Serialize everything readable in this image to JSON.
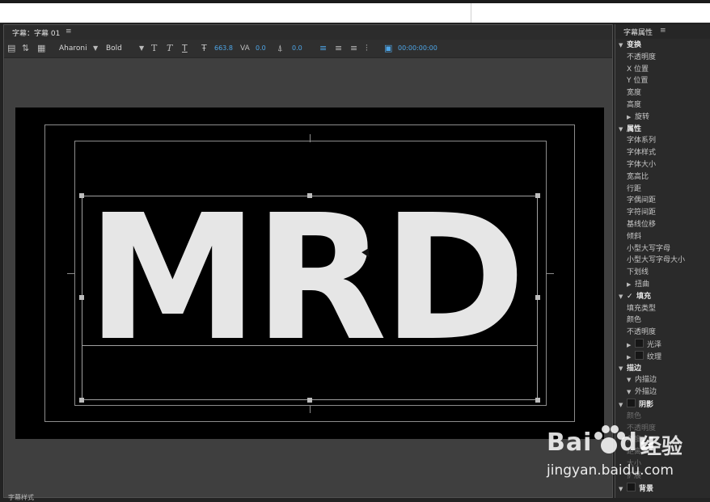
{
  "colors": {
    "accent": "#4ea6e8",
    "canvas": "#000000",
    "panel": "#3a3a3a",
    "text_fill": "#e6e6e6"
  },
  "title_panel": {
    "title": "字幕：字幕 01",
    "menu_icon": "≡",
    "toolbar": {
      "font_family": "Aharoni",
      "font_style": "Bold",
      "font_size": "663.8",
      "tracking": "0.0",
      "leading": "0.0",
      "timecode": "00:00:00:00"
    },
    "canvas_text": "MRD"
  },
  "bottom_tab": "字幕样式",
  "properties": {
    "title": "字幕属性",
    "menu_icon": "≡",
    "rows": [
      {
        "label": "变换",
        "kind": "section",
        "arrow": "▼"
      },
      {
        "label": "不透明度",
        "kind": "item"
      },
      {
        "label": "X 位置",
        "kind": "item"
      },
      {
        "label": "Y 位置",
        "kind": "item"
      },
      {
        "label": "宽度",
        "kind": "item"
      },
      {
        "label": "高度",
        "kind": "item"
      },
      {
        "label": "旋转",
        "kind": "item",
        "arrow": "▶"
      },
      {
        "label": "属性",
        "kind": "section",
        "arrow": "▼"
      },
      {
        "label": "字体系列",
        "kind": "item"
      },
      {
        "label": "字体样式",
        "kind": "item"
      },
      {
        "label": "字体大小",
        "kind": "item"
      },
      {
        "label": "宽高比",
        "kind": "item"
      },
      {
        "label": "行距",
        "kind": "item"
      },
      {
        "label": "字偶间距",
        "kind": "item"
      },
      {
        "label": "字符间距",
        "kind": "item"
      },
      {
        "label": "基线位移",
        "kind": "item"
      },
      {
        "label": "倾斜",
        "kind": "item"
      },
      {
        "label": "小型大写字母",
        "kind": "item"
      },
      {
        "label": "小型大写字母大小",
        "kind": "item"
      },
      {
        "label": "下划线",
        "kind": "item"
      },
      {
        "label": "扭曲",
        "kind": "item",
        "arrow": "▶"
      },
      {
        "label": "填充",
        "kind": "section",
        "arrow": "▼",
        "checked": true
      },
      {
        "label": "填充类型",
        "kind": "item"
      },
      {
        "label": "颜色",
        "kind": "item"
      },
      {
        "label": "不透明度",
        "kind": "item"
      },
      {
        "label": "光泽",
        "kind": "item",
        "arrow": "▶",
        "box": true
      },
      {
        "label": "纹理",
        "kind": "item",
        "arrow": "▶",
        "box": true
      },
      {
        "label": "描边",
        "kind": "section",
        "arrow": "▼"
      },
      {
        "label": "内描边",
        "kind": "item",
        "arrow": "▼"
      },
      {
        "label": "外描边",
        "kind": "item",
        "arrow": "▼"
      },
      {
        "label": "阴影",
        "kind": "section",
        "arrow": "▼",
        "box": true
      },
      {
        "label": "颜色",
        "kind": "dim"
      },
      {
        "label": "不透明度",
        "kind": "dim"
      },
      {
        "label": "角度",
        "kind": "dim"
      },
      {
        "label": "距离",
        "kind": "dim"
      },
      {
        "label": "大小",
        "kind": "dim"
      },
      {
        "label": "扩展",
        "kind": "dim"
      },
      {
        "label": "背景",
        "kind": "section",
        "arrow": "▼",
        "box": true
      }
    ]
  },
  "watermark": {
    "logo": "Bai",
    "logo_tail": "du",
    "cn": "经验",
    "url": "jingyan.baidu.com"
  }
}
